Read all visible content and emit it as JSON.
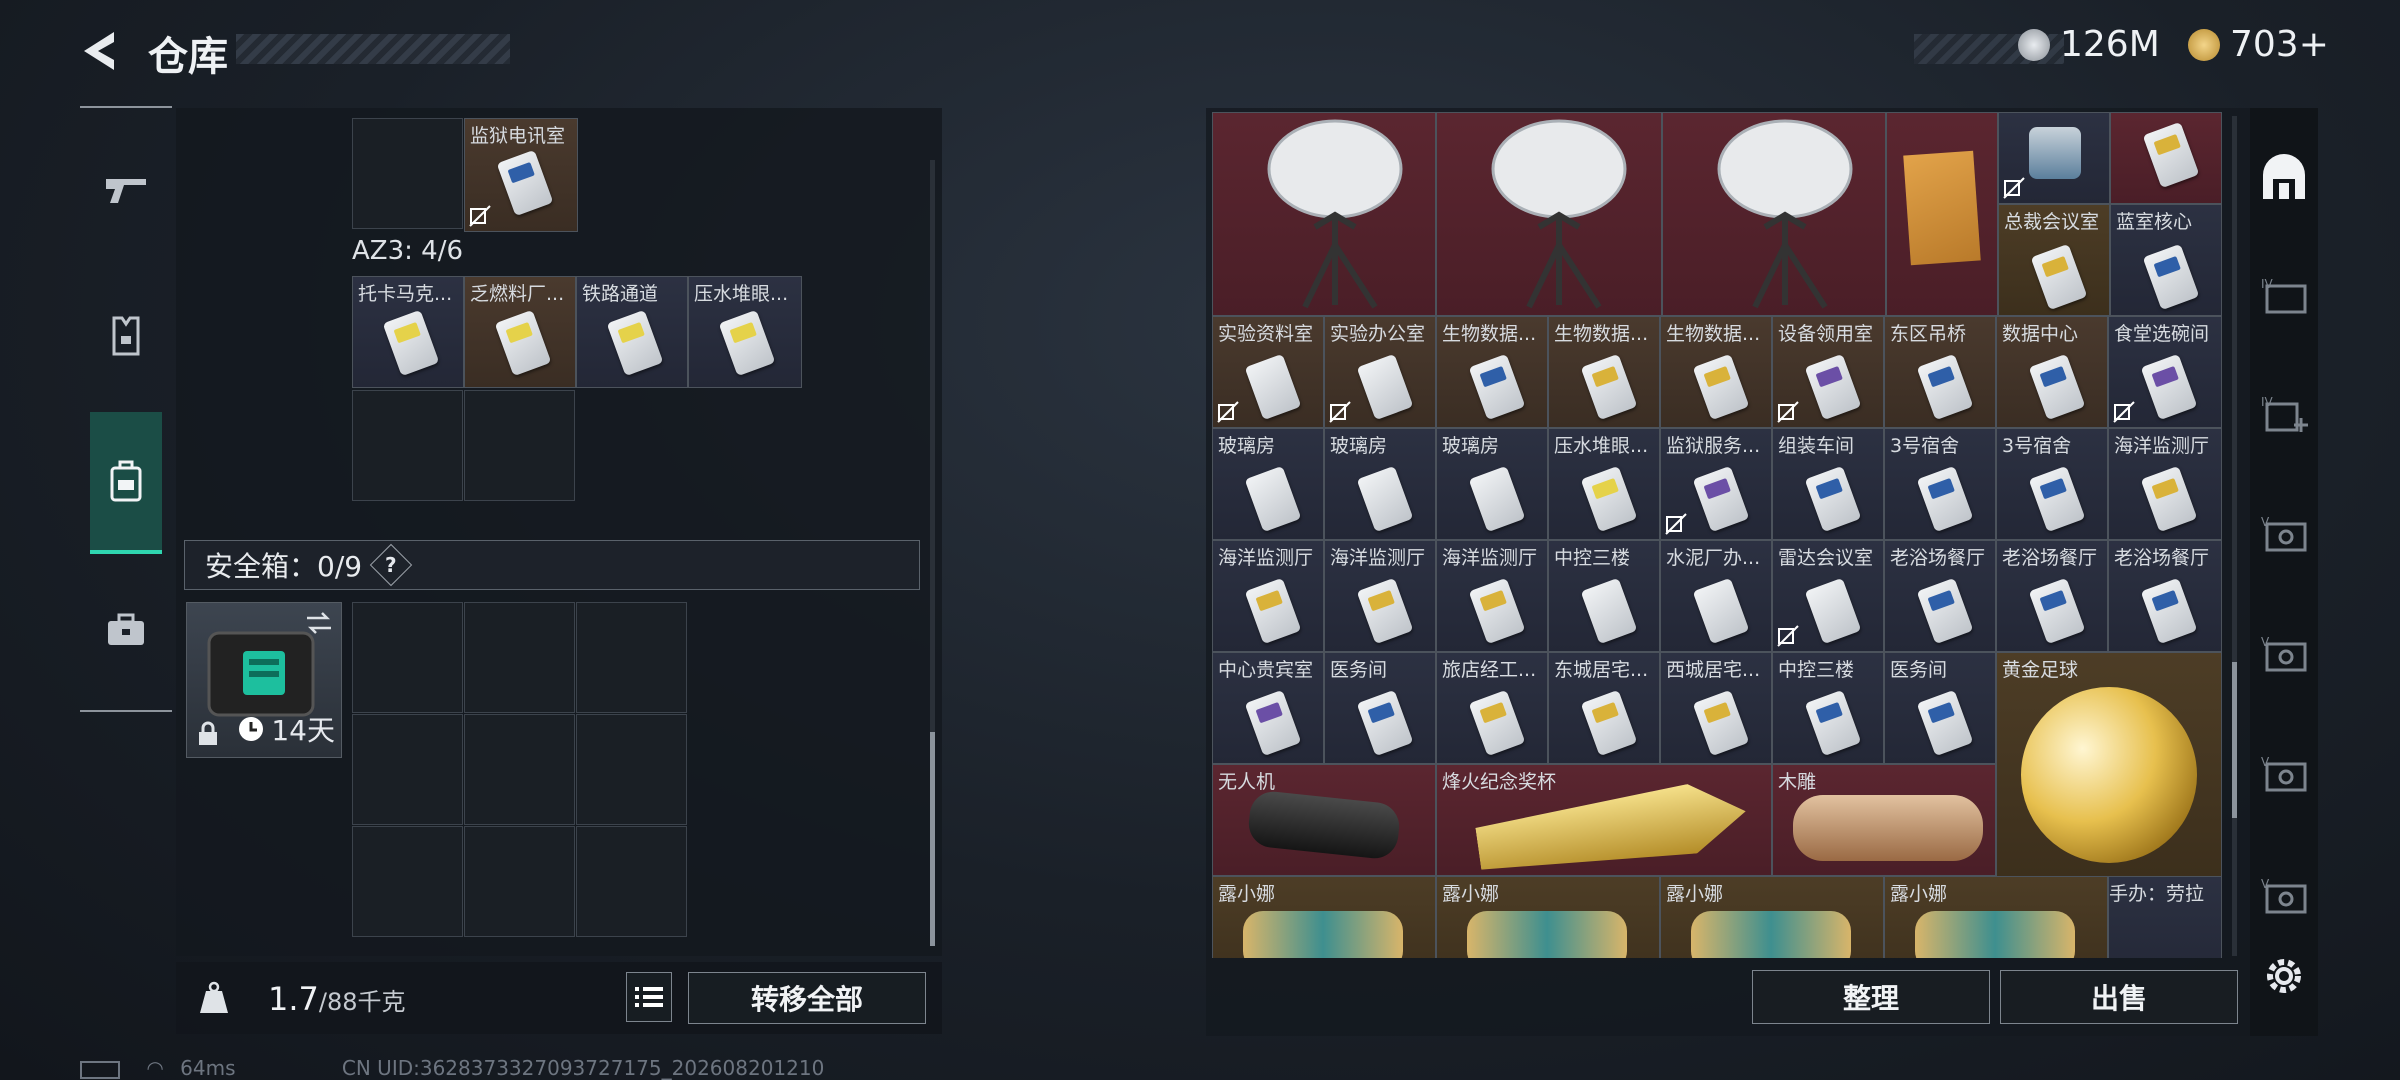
{
  "header": {
    "title": "仓库",
    "currency_silver": "126M",
    "currency_gold": "703+"
  },
  "left": {
    "top_cell_label": "监狱电讯室",
    "az3_label": "AZ3: 4/6",
    "az3_items": [
      "托卡马克...",
      "乏燃料厂...",
      "铁路通道",
      "压水堆眼..."
    ],
    "safebox_title": "安全箱：0/9",
    "safebox_help": "?",
    "safebox_days": "14天",
    "weight_value": "1.7",
    "weight_max": "/88千克",
    "transfer_all": "转移全部"
  },
  "right": {
    "row2": [
      "总裁会议室",
      "蓝室核心"
    ],
    "row3": [
      "实验资料室",
      "实验办公室",
      "生物数据...",
      "生物数据...",
      "生物数据...",
      "设备领用室",
      "东区吊桥",
      "数据中心",
      "食堂选碗间"
    ],
    "row4": [
      "玻璃房",
      "玻璃房",
      "玻璃房",
      "压水堆眼...",
      "监狱服务...",
      "组装车间",
      "3号宿舍",
      "3号宿舍",
      "海洋监测厅"
    ],
    "row5": [
      "海洋监测厅",
      "海洋监测厅",
      "海洋监测厅",
      "中控三楼",
      "水泥厂办...",
      "雷达会议室",
      "老浴场餐厅",
      "老浴场餐厅",
      "老浴场餐厅"
    ],
    "row6": [
      "中心贵宾室",
      "医务间",
      "旅店经工...",
      "东城居宅...",
      "西城居宅...",
      "中控三楼",
      "医务间"
    ],
    "gold_ball": "黄金足球",
    "row7": [
      "无人机",
      "烽火纪念奖杯",
      "木雕"
    ],
    "row8": [
      "露小娜",
      "露小娜",
      "露小娜",
      "露小娜",
      "手办：劳拉"
    ],
    "sort_btn": "整理",
    "sell_btn": "出售"
  },
  "status": {
    "ping": "64ms",
    "uid": "CN UID:3628373327093727175_202608201210"
  },
  "colors": {
    "accent": "#2fd6b0",
    "cell_blue": "#2c3142",
    "cell_brown": "#4a3a2e",
    "cell_red": "#5b2630"
  }
}
